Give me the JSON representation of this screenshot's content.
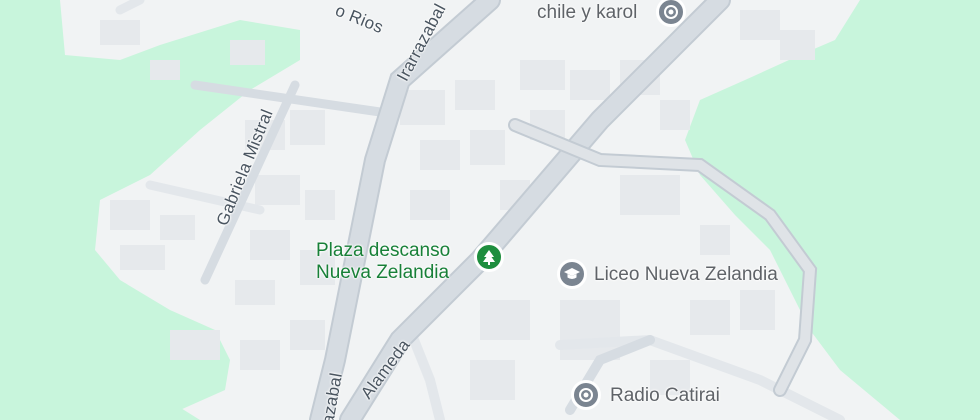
{
  "map": {
    "colors": {
      "land": "#f1f3f4",
      "green": "#c8f5dc",
      "road": "#d6dce2",
      "road_edge": "#c3cbd3",
      "minor_road": "#e3e7eb",
      "building": "#e6e9ec",
      "poi_gray": "#7b8591",
      "park_green": "#1e8e3e"
    },
    "streets": {
      "rios": "o Rios",
      "irarrazabal_top": "Irarrazabal",
      "gabriela_mistral": "Gabriela Mistral",
      "alameda": "Alameda",
      "irarrazabal_bottom": "razabal"
    },
    "pois": {
      "chile_karol": {
        "name": "chile y karol",
        "icon": "place-pin-icon"
      },
      "plaza": {
        "line1": "Plaza descanso",
        "line2": "Nueva Zelandia",
        "icon": "park-tree-icon"
      },
      "liceo": {
        "name": "Liceo Nueva Zelandia",
        "icon": "school-cap-icon"
      },
      "radio": {
        "name": "Radio Catirai",
        "icon": "place-pin-icon"
      }
    }
  }
}
